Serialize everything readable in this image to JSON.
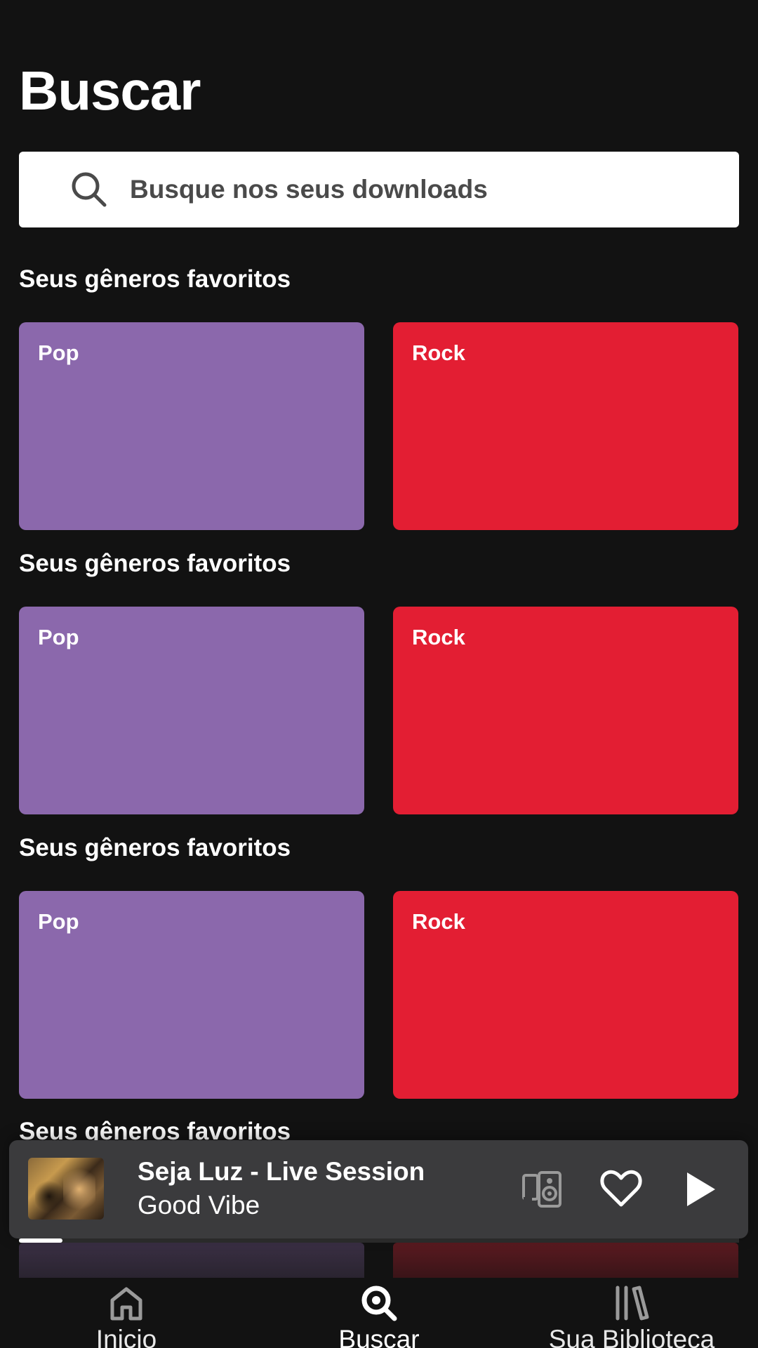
{
  "header": {
    "title": "Buscar"
  },
  "search": {
    "placeholder": "Busque nos seus downloads",
    "icon": "search-icon"
  },
  "sections": [
    {
      "heading": "Seus gêneros favoritos",
      "genres": [
        {
          "label": "Pop",
          "color": "#8b68ac"
        },
        {
          "label": "Rock",
          "color": "#e31e33"
        }
      ]
    },
    {
      "heading": "Seus gêneros favoritos",
      "genres": [
        {
          "label": "Pop",
          "color": "#8b68ac"
        },
        {
          "label": "Rock",
          "color": "#e31e33"
        }
      ]
    },
    {
      "heading": "Seus gêneros favoritos",
      "genres": [
        {
          "label": "Pop",
          "color": "#8b68ac"
        },
        {
          "label": "Rock",
          "color": "#e31e33"
        }
      ]
    },
    {
      "heading": "Seus gêneros favoritos",
      "genres": []
    }
  ],
  "player": {
    "title": "Seja Luz - Live Session",
    "artist": "Good Vibe",
    "progress": 0.06,
    "icons": [
      "devices-icon",
      "heart-icon",
      "play-icon"
    ]
  },
  "nav": {
    "items": [
      {
        "label": "Inicio",
        "icon": "home-icon",
        "active": false
      },
      {
        "label": "Buscar",
        "icon": "search-icon",
        "active": true
      },
      {
        "label": "Sua Biblioteca",
        "icon": "library-icon",
        "active": false
      }
    ]
  },
  "colors": {
    "background": "#121212",
    "pop": "#8b68ac",
    "rock": "#e31e33",
    "player_bg": "#3b3b3d"
  }
}
